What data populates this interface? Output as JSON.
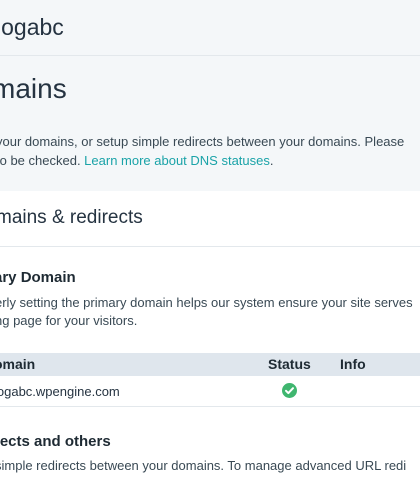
{
  "site": {
    "name": "logabc"
  },
  "page": {
    "title": "mains",
    "intro_line1": "your domains, or setup simple redirects between your domains. Please",
    "intro_line2_prefix": "to be checked. ",
    "intro_link": "Learn more about DNS statuses",
    "intro_line2_suffix": "."
  },
  "card": {
    "title": "mains & redirects",
    "primary": {
      "title": "ary Domain",
      "desc_line1": "erly setting the primary domain helps our system ensure your site serves",
      "desc_line2": "ng page for your visitors."
    },
    "table": {
      "headers": {
        "domain": "omain",
        "status": "Status",
        "info": "Info"
      },
      "rows": [
        {
          "domain": "logabc.wpengine.com",
          "status_icon": "check-circle-icon",
          "status_color": "#3fb66f"
        }
      ]
    },
    "redirects": {
      "title": "rects and others",
      "desc": "simple redirects between your domains. To manage advanced URL redi"
    }
  }
}
